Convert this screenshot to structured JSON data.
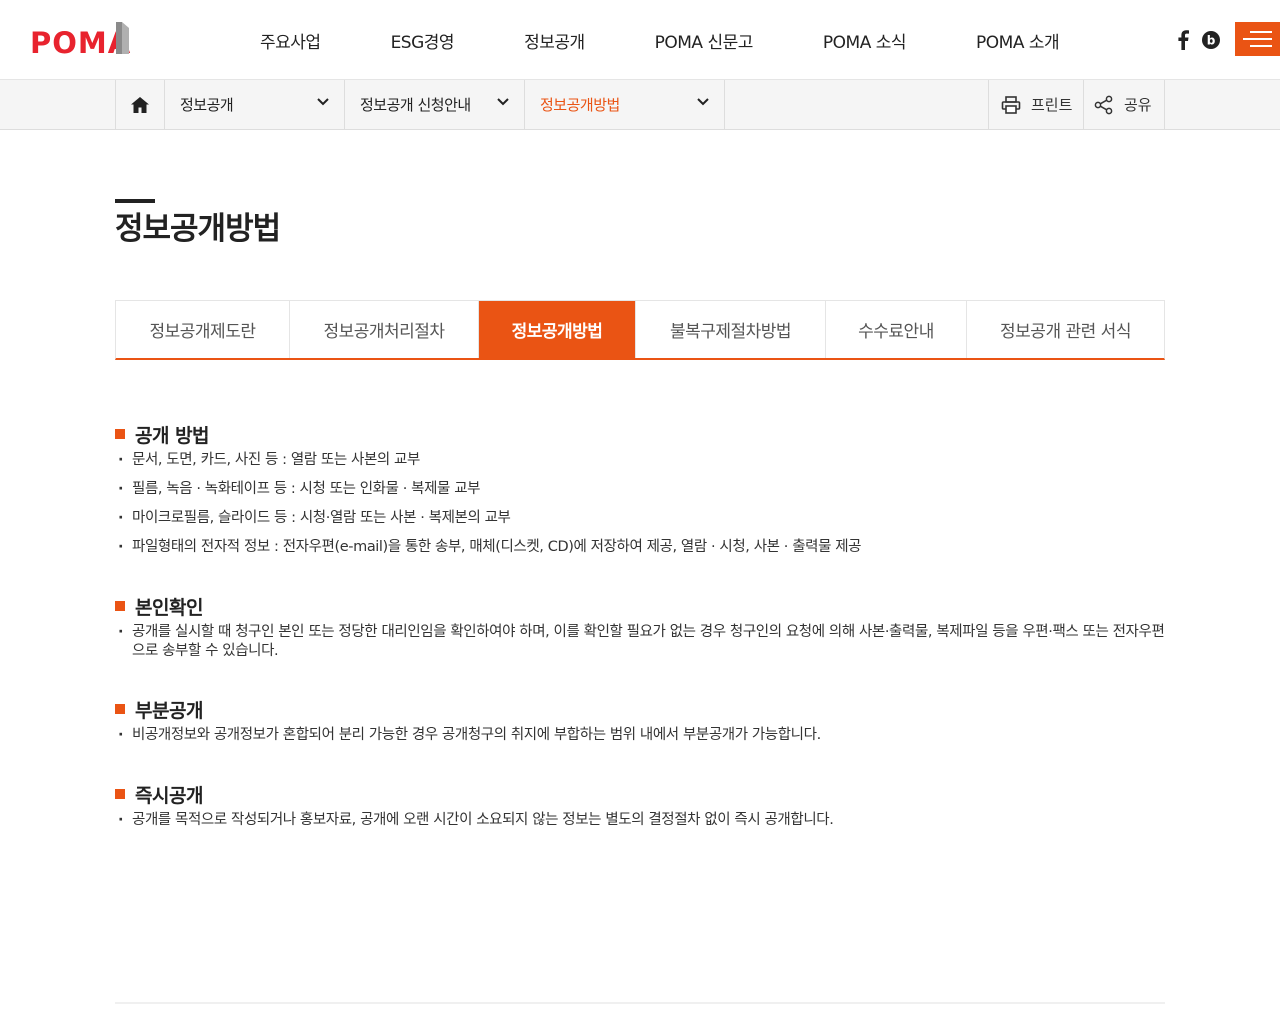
{
  "brand": {
    "logo_text": "POMA",
    "accent_color": "#ea5414"
  },
  "gnb": {
    "items": [
      "주요사업",
      "ESG경영",
      "정보공개",
      "POMA 신문고",
      "POMA 소식",
      "POMA 소개"
    ]
  },
  "sns": {
    "facebook_icon": "facebook-icon",
    "blog_icon": "blog-icon"
  },
  "location": {
    "home_icon": "home-icon",
    "depth1": "정보공개",
    "depth2": "정보공개 신청안내",
    "depth3": "정보공개방법",
    "print_label": "프린트",
    "share_label": "공유"
  },
  "page": {
    "title": "정보공개방법"
  },
  "tabs": [
    {
      "label": "정보공개제도란",
      "active": false
    },
    {
      "label": "정보공개처리절차",
      "active": false
    },
    {
      "label": "정보공개방법",
      "active": true
    },
    {
      "label": "불복구제절차방법",
      "active": false
    },
    {
      "label": "수수료안내",
      "active": false
    },
    {
      "label": "정보공개 관련 서식",
      "active": false
    }
  ],
  "sections": [
    {
      "title": "공개 방법",
      "items": [
        "문서, 도면, 카드, 사진 등 : 열람 또는 사본의 교부",
        "필름, 녹음 · 녹화테이프 등 : 시청 또는 인화물 · 복제물 교부",
        "마이크로필름, 슬라이드 등 : 시청·열람 또는 사본 · 복제본의 교부",
        "파일형태의 전자적 정보 : 전자우편(e-mail)을 통한 송부, 매체(디스켓, CD)에 저장하여 제공, 열람 · 시청, 사본 · 출력물 제공"
      ]
    },
    {
      "title": "본인확인",
      "items": [
        "공개를 실시할 때 청구인 본인 또는 정당한 대리인임을 확인하여야 하며, 이를 확인할 필요가 없는 경우 청구인의 요청에 의해 사본·출력물, 복제파일 등을 우편·팩스 또는 전자우편으로 송부할 수 있습니다."
      ]
    },
    {
      "title": "부분공개",
      "items": [
        "비공개정보와 공개정보가 혼합되어 분리 가능한 경우 공개청구의 취지에 부합하는 범위 내에서 부분공개가 가능합니다."
      ]
    },
    {
      "title": "즉시공개",
      "items": [
        "공개를 목적으로 작성되거나 홍보자료, 공개에 오랜 시간이 소요되지 않는 정보는 별도의 결정절차 없이 즉시 공개합니다."
      ]
    }
  ]
}
